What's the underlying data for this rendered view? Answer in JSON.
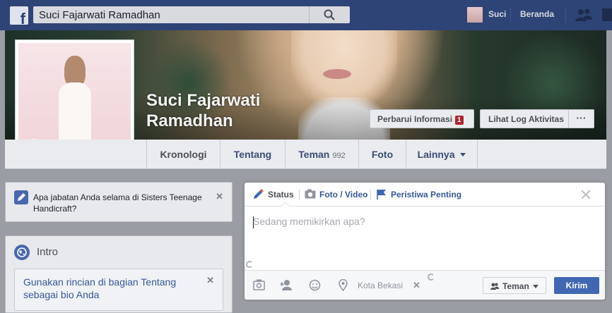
{
  "topbar": {
    "search_value": "Suci Fajarwati Ramadhan",
    "user_name": "Suci",
    "home_label": "Beranda"
  },
  "profile": {
    "name_line1": "Suci Fajarwati",
    "name_line2": "Ramadhan",
    "update_info_label": "Perbarui Informasi",
    "update_info_badge": "1",
    "activity_log_label": "Lihat Log Aktivitas",
    "more_label": "···"
  },
  "nav": {
    "tabs": [
      {
        "label": "Kronologi"
      },
      {
        "label": "Tentang"
      },
      {
        "label": "Teman",
        "count": "992"
      },
      {
        "label": "Foto"
      },
      {
        "label": "Lainnya"
      }
    ]
  },
  "question_card": {
    "text": "Apa jabatan Anda selama di Sisters Teenage Handicraft?",
    "close": "✕"
  },
  "intro": {
    "title": "Intro",
    "hint": "Gunakan rincian di bagian Tentang sebagai bio Anda",
    "close": "✕"
  },
  "composer": {
    "tabs": [
      {
        "label": "Status"
      },
      {
        "label": "Foto / Video"
      },
      {
        "label": "Peristiwa Penting"
      }
    ],
    "placeholder": "Sedang memikirkan apa?",
    "location": "Kota Bekasi",
    "location_close": "✕",
    "audience_label": "Teman",
    "send_label": "Kirim",
    "close": "✕"
  },
  "colors": {
    "topbar": "#2f4476",
    "link": "#365899",
    "primary_button": "#4267b2",
    "badge": "#b1252e"
  }
}
